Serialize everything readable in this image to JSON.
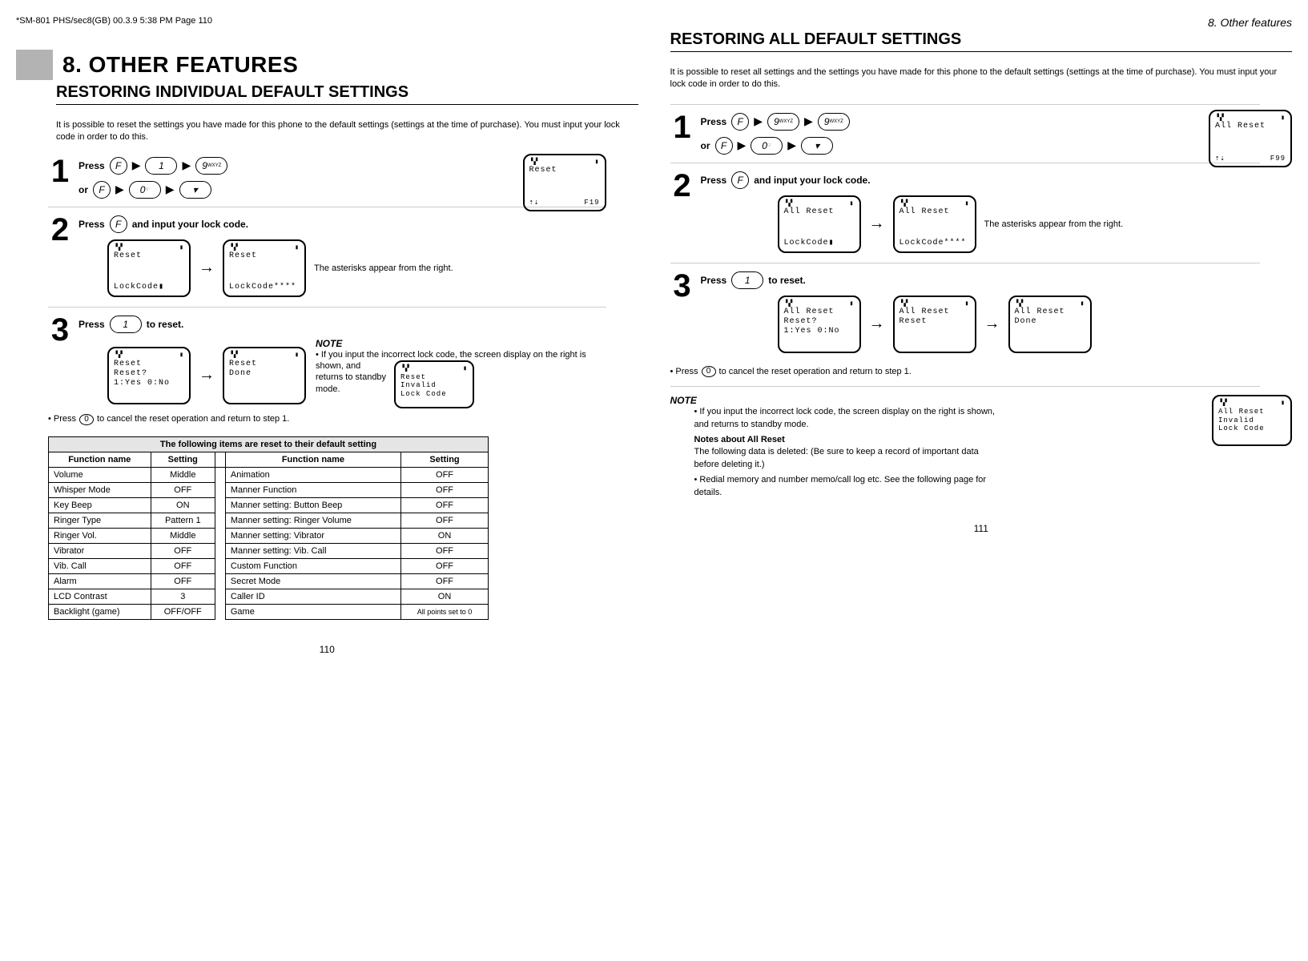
{
  "print_mark": "*SM-801 PHS/sec8(GB)  00.3.9 5:38 PM  Page 110",
  "chapter_num": "8.",
  "chapter_title": "OTHER FEATURES",
  "chapter_label": "8. Other features",
  "left": {
    "section_title": "RESTORING INDIVIDUAL DEFAULT SETTINGS",
    "intro": "It is possible to reset the settings you have made for this phone to the default settings (settings at the time of purchase). You must input your lock code in order to do this.",
    "step1": {
      "press": "Press",
      "or": "or",
      "keys": {
        "F": "F",
        "1": "1",
        "9": "9",
        "9sub": "WXYZ",
        "0": "0",
        "0sub": "☞",
        "down": "▾"
      }
    },
    "screen1": {
      "l1": "Reset",
      "code": "F19"
    },
    "step2": {
      "text_a": "Press",
      "text_b": "and input your lock code.",
      "key": "F"
    },
    "screen2a": {
      "l1": "Reset",
      "l2": "LockCode▮"
    },
    "screen2b": {
      "l1": "Reset",
      "l2": "LockCode****"
    },
    "caption2": "The asterisks appear from the right.",
    "step3": {
      "text_a": "Press",
      "text_b": "to reset.",
      "key": "1"
    },
    "screen3a": {
      "l1": "Reset",
      "l2": "Reset?",
      "l3": "1:Yes  0:No"
    },
    "screen3b": {
      "l1": "Reset",
      "l2": "Done"
    },
    "note_title": "NOTE",
    "note_body_a": "• If you input the incorrect lock code, the screen display on the right is",
    "note_body_b": "shown, and returns to standby mode.",
    "screen_err": {
      "l1": "Reset",
      "l2": "Invalid",
      "l3": "Lock Code"
    },
    "cancel_a": "• Press",
    "cancel_b": "to cancel the reset operation and return to step 1.",
    "table_title": "The following items are reset to their default setting",
    "th_func": "Function name",
    "th_set": "Setting",
    "rows_left": [
      [
        "Volume",
        "Middle"
      ],
      [
        "Whisper Mode",
        "OFF"
      ],
      [
        "Key Beep",
        "ON"
      ],
      [
        "Ringer Type",
        "Pattern 1"
      ],
      [
        "Ringer Vol.",
        "Middle"
      ],
      [
        "Vibrator",
        "OFF"
      ],
      [
        "Vib. Call",
        "OFF"
      ],
      [
        "Alarm",
        "OFF"
      ],
      [
        "LCD Contrast",
        "3"
      ],
      [
        "Backlight (game)",
        "OFF/OFF"
      ]
    ],
    "rows_right": [
      [
        "Animation",
        "OFF"
      ],
      [
        "Manner Function",
        "OFF"
      ],
      [
        "Manner setting: Button Beep",
        "OFF"
      ],
      [
        "Manner setting: Ringer Volume",
        "OFF"
      ],
      [
        "Manner setting: Vibrator",
        "ON"
      ],
      [
        "Manner setting: Vib. Call",
        "OFF"
      ],
      [
        "Custom Function",
        "OFF"
      ],
      [
        "Secret Mode",
        "OFF"
      ],
      [
        "Caller ID",
        "ON"
      ],
      [
        "Game",
        "All points set to 0"
      ]
    ],
    "page": "110"
  },
  "right": {
    "section_title": "RESTORING ALL DEFAULT SETTINGS",
    "intro": "It is possible to reset all settings and the settings you have made for this phone to the default settings (settings at the time of purchase). You must input your lock code in order to do this.",
    "step1": {
      "press": "Press",
      "or": "or",
      "keys": {
        "F": "F",
        "9": "9",
        "9sub": "WXYZ",
        "0": "0",
        "0sub": "☞",
        "down": "▾"
      }
    },
    "screen1": {
      "l1": "All Reset",
      "code": "F99"
    },
    "step2": {
      "text_a": "Press",
      "text_b": "and input your lock code.",
      "key": "F"
    },
    "screen2a": {
      "l1": "All Reset",
      "l2": "LockCode▮"
    },
    "screen2b": {
      "l1": "All Reset",
      "l2": "LockCode****"
    },
    "caption2": "The asterisks appear from the right.",
    "step3": {
      "text_a": "Press",
      "text_b": "to reset.",
      "key": "1"
    },
    "screen3a": {
      "l1": "All Reset",
      "l2": "Reset?",
      "l3": "1:Yes  0:No"
    },
    "screen3b": {
      "l1": "All Reset",
      "l2": "Reset"
    },
    "screen3c": {
      "l1": "All Reset",
      "l2": "Done"
    },
    "cancel_a": "• Press",
    "cancel_b": "to cancel the reset operation and return to step 1.",
    "note_title": "NOTE",
    "note1": "• If you input the incorrect lock code, the screen display on the right is shown, and returns to standby mode.",
    "notes_sub": "Notes about All Reset",
    "note2": "The following data is deleted: (Be sure to keep a record of important data before deleting it.)",
    "note3": "• Redial memory and number memo/call log etc. See the following page for details.",
    "screen_err": {
      "l1": "All Reset",
      "l2": "Invalid",
      "l3": "Lock Code"
    },
    "page": "111"
  },
  "ui": {
    "signal": "▝▞",
    "batt": "▮"
  }
}
